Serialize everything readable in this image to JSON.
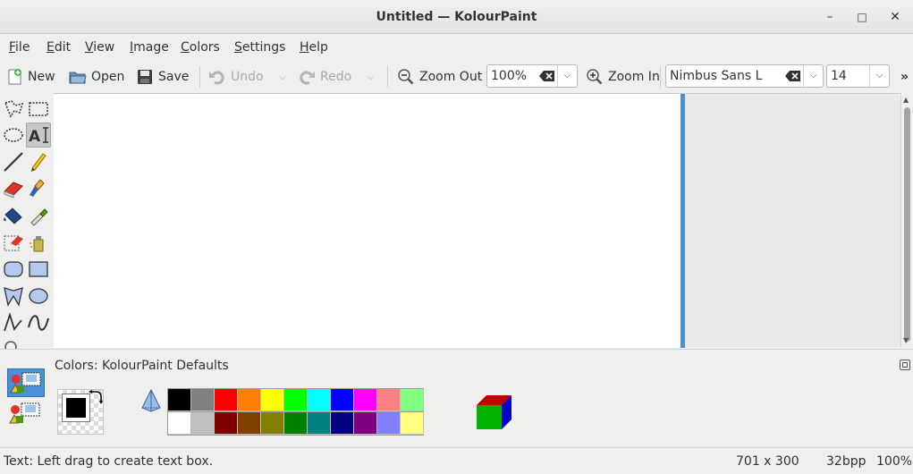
{
  "window": {
    "title": "Untitled — KolourPaint",
    "controls": [
      "–",
      "□",
      "✕"
    ]
  },
  "menubar": {
    "items": [
      {
        "label": "File",
        "accel": "F",
        "rest": "ile"
      },
      {
        "label": "Edit",
        "accel": "E",
        "rest": "dit"
      },
      {
        "label": "View",
        "accel": "V",
        "rest": "iew"
      },
      {
        "label": "Image",
        "accel": "I",
        "rest": "mage"
      },
      {
        "label": "Colors",
        "accel": "C",
        "rest": "olors"
      },
      {
        "label": "Settings",
        "accel": "S",
        "rest": "ettings"
      },
      {
        "label": "Help",
        "accel": "H",
        "rest": "elp"
      }
    ]
  },
  "toolbar": {
    "new_label": "New",
    "open_label": "Open",
    "save_label": "Save",
    "undo_label": "Undo",
    "redo_label": "Redo",
    "zoom_out_label": "Zoom Out",
    "zoom_value": "100%",
    "zoom_in_label": "Zoom In",
    "font_family": "Nimbus Sans L",
    "font_size": "14",
    "overflow": "»"
  },
  "colorbox": {
    "title": "Colors: KolourPaint Defaults",
    "foreground": "#000000",
    "background": "#ffffff",
    "palette_row1": [
      "#000000",
      "#808080",
      "#ff0000",
      "#ff8000",
      "#ffff00",
      "#00ff00",
      "#00ffff",
      "#0000ff",
      "#ff00ff",
      "#ff8080",
      "#80ff80"
    ],
    "palette_row2": [
      "#ffffff",
      "#c0c0c0",
      "#800000",
      "#804000",
      "#808000",
      "#008000",
      "#008080",
      "#000080",
      "#800080",
      "#8080ff",
      "#ffff80"
    ]
  },
  "status": {
    "message": "Text: Left drag to create text box.",
    "dimensions": "701 x 300",
    "depth": "32bpp",
    "zoom": "100%"
  },
  "colors": {
    "accent": "#4a90d9"
  }
}
